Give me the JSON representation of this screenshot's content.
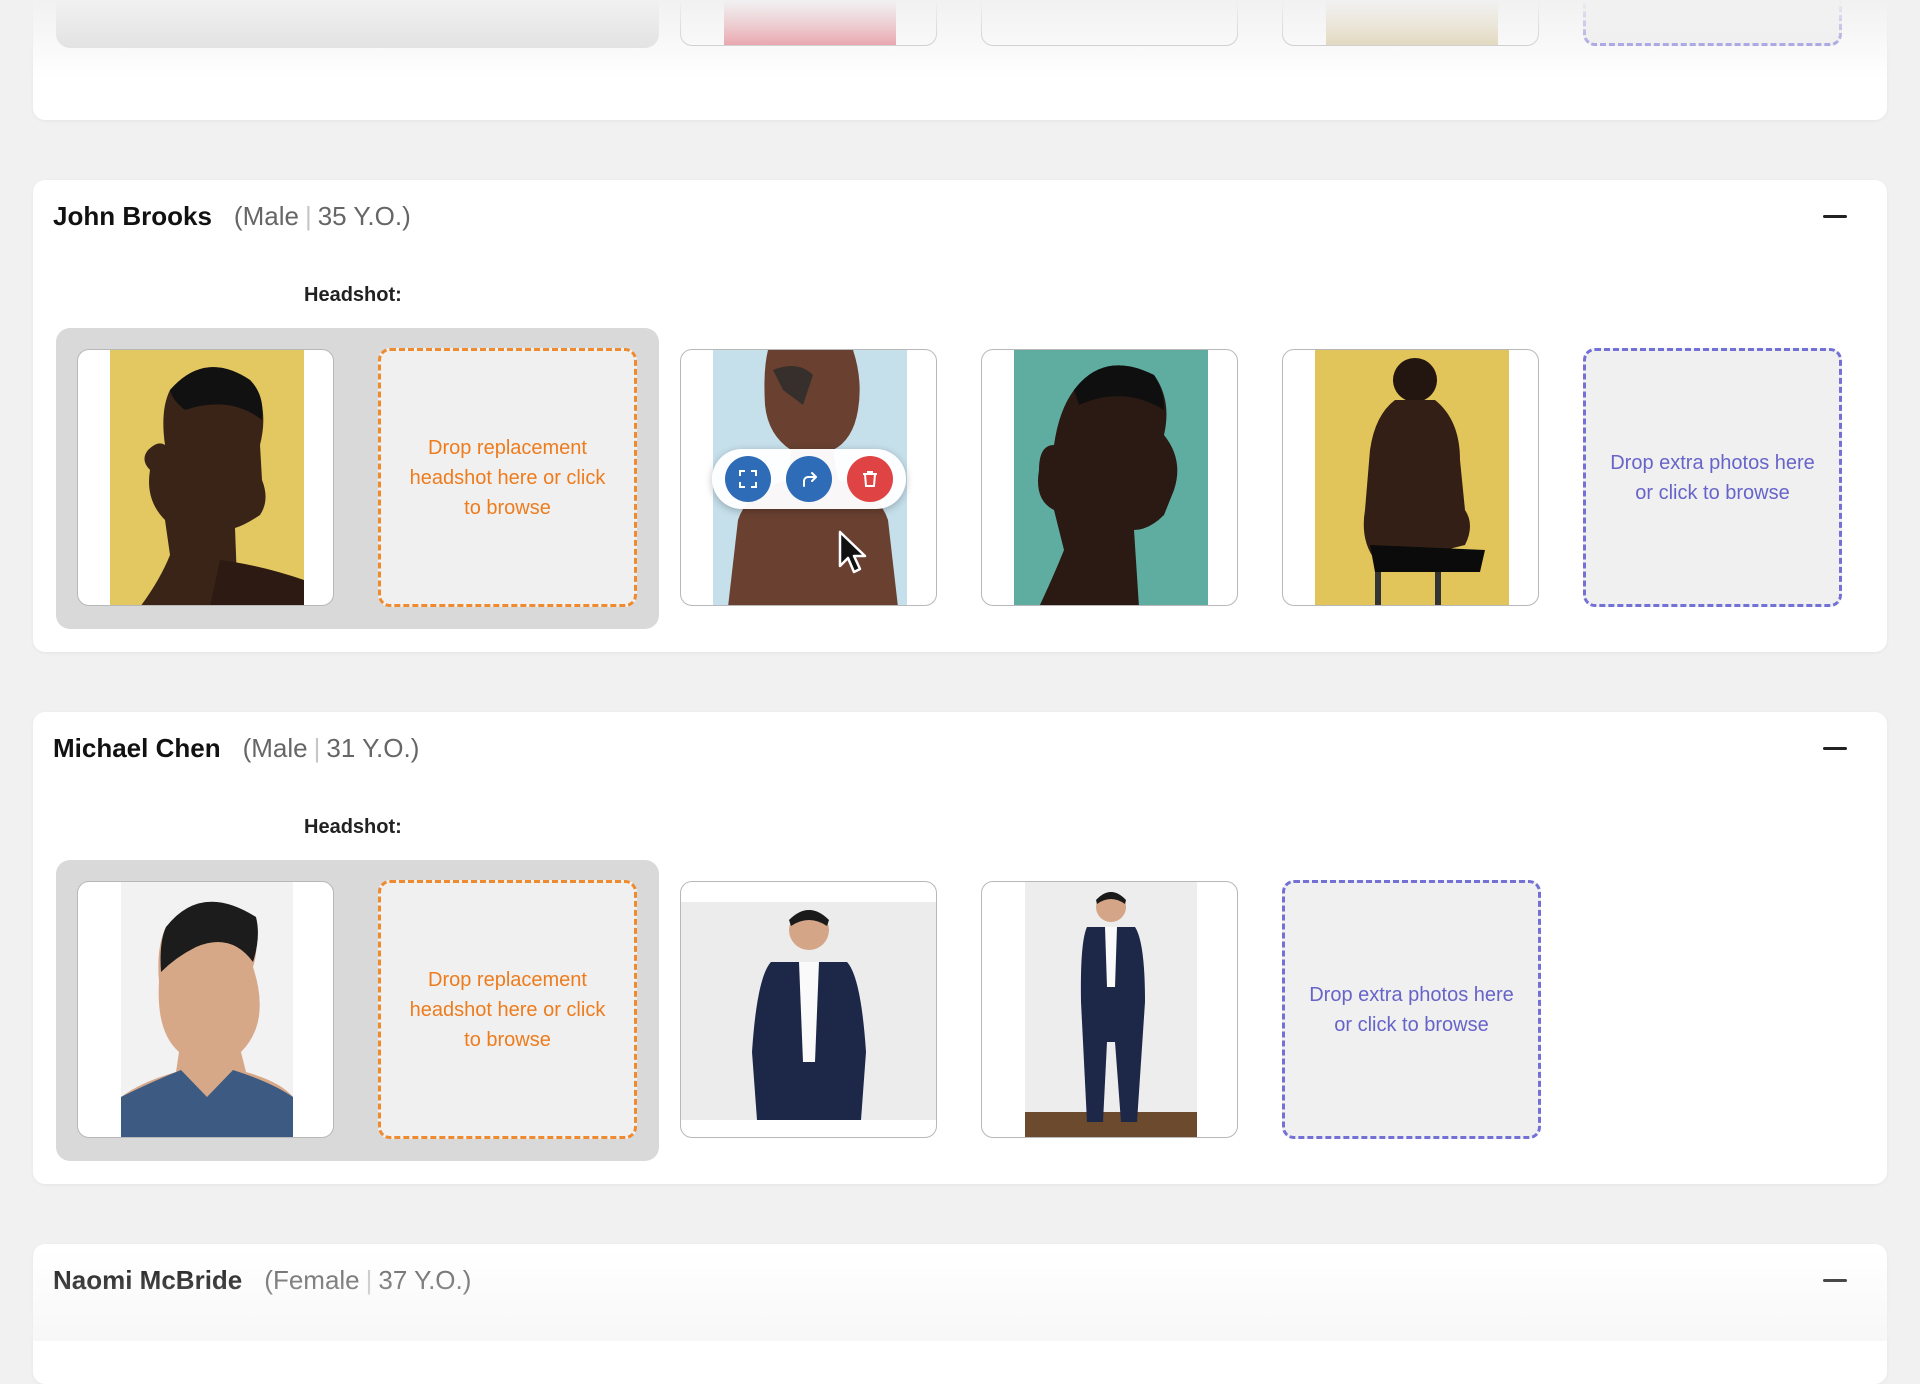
{
  "colors": {
    "headshot_drop": "#ee7c1d",
    "extra_drop": "#6764c9",
    "action_blue": "#2f6cb7",
    "action_red": "#e04343"
  },
  "top_card": {
    "drop_texts": [
      "",
      ""
    ]
  },
  "actors": [
    {
      "name": "John Brooks",
      "gender": "Male",
      "age": "35 Y.O.",
      "headshot_label": "Headshot:",
      "headshot_drop_text": "Drop replacement headshot here or click to browse",
      "extra_drop_text": "Drop extra photos here or click to browse",
      "photos": [
        "headshot-profile-yellow",
        "face-paint-blue",
        "profile-teal",
        "seated-back-yellow"
      ]
    },
    {
      "name": "Michael Chen",
      "gender": "Male",
      "age": "31 Y.O.",
      "headshot_label": "Headshot:",
      "headshot_drop_text": "Drop replacement headshot here or click to browse",
      "extra_drop_text": "Drop extra photos here or click to browse",
      "photos": [
        "headshot-denim-shirt",
        "suit-seated",
        "suit-standing"
      ]
    },
    {
      "name": "Naomi McBride",
      "gender": "Female",
      "age": "37 Y.O."
    }
  ],
  "photo_actions": {
    "icons": [
      "fullscreen-icon",
      "share-icon",
      "trash-icon"
    ]
  }
}
